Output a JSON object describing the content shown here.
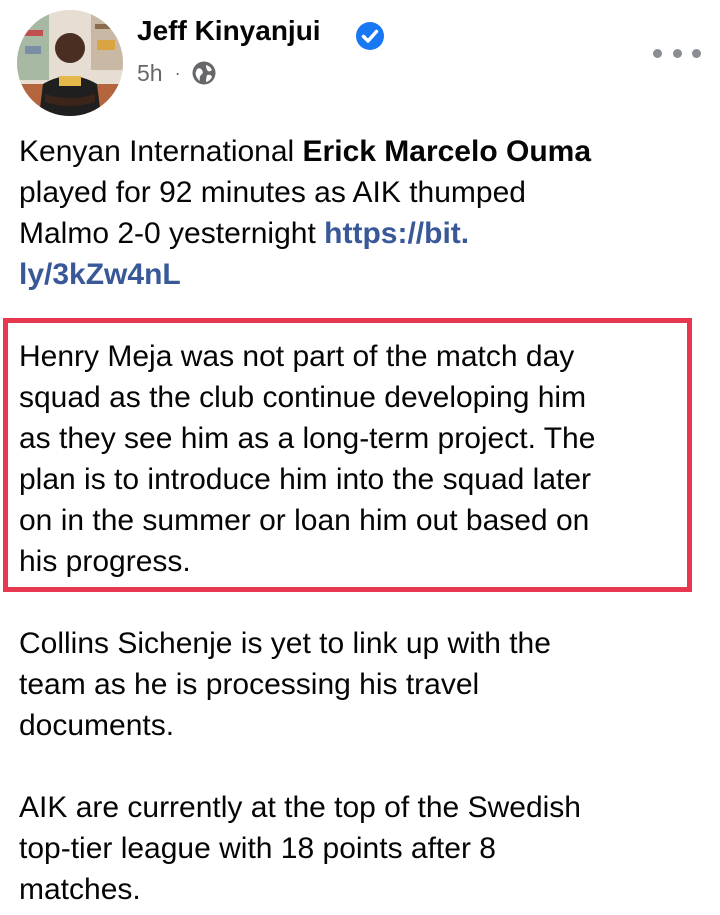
{
  "post": {
    "author": "Jeff Kinyanjui",
    "verified": true,
    "time": "5h",
    "audience_icon": "globe-icon",
    "more_icon": "more-options-icon",
    "body": {
      "p1_pre": "Kenyan International ",
      "p1_bold": "Erick Marcelo Ouma",
      "p1_line2": "played for 92 minutes as AIK thumped",
      "p1_line3_pre": "Malmo 2-0 yesternight ",
      "link_line1": "https://bit.",
      "link_line2": "ly/3kZw4nL",
      "p2_lines": [
        "Henry Meja was not part of the match day",
        "squad as the club continue developing him",
        "as they see him as a long-term project. The",
        "plan is to introduce him into the squad later",
        "on in the summer or loan him out based on",
        "his progress."
      ],
      "p3_lines": [
        "Collins Sichenje is yet to link up with the",
        "team as he is processing his travel",
        "documents."
      ],
      "p4_lines": [
        "AIK are currently at the top of the Swedish",
        "top-tier league with 18 points after 8",
        "matches."
      ]
    }
  },
  "colors": {
    "highlight_border": "#e8384f",
    "link": "#385898",
    "verified_badge": "#1877f2",
    "secondary_text": "#65676b"
  }
}
